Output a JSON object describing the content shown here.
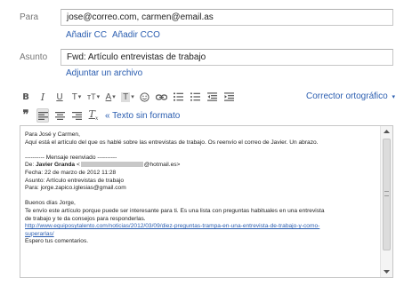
{
  "recipients": {
    "to_label": "Para",
    "to_value": "jose@correo.com, carmen@email.as",
    "add_cc": "Añadir CC",
    "add_bcc": "Añadir CCO"
  },
  "subject": {
    "label": "Asunto",
    "value": "Fwd: Artículo entrevistas de trabajo",
    "attach_link": "Adjuntar un archivo"
  },
  "toolbar": {
    "bold": "B",
    "italic": "I",
    "underline": "U",
    "font": "T",
    "size": "тT",
    "text_color": "A",
    "bg_color": "T",
    "spellcheck": "Corrector ortográfico",
    "remove_format": "« Texto sin formato"
  },
  "editor": {
    "lines": {
      "l1": "Para José y Carmen,",
      "l2": "Aquí está el artículo del que os hablé sobre las entrevistas de trabajo. Os reenvío el correo de Javier. Un abrazo.",
      "fwd_header": "---------- Mensaje reenviado ----------",
      "de_label": "De:",
      "de_name": "Javier Granda",
      "de_lt": "<",
      "de_email_suffix": "@hotmail.es>",
      "fecha": "Fecha: 22 de marzo de 2012 11:28",
      "asunto": "Asunto: Artículo entrevistas de trabajo",
      "para": "Para: jorge.zapico.iglesias@gmail.com",
      "greeting": "Buenos días Jorge,",
      "body1": "Te envío este artículo porque puede ser interesante para ti. Es una lista con preguntas habituales en una entrevista",
      "body2": "de trabajo y te da consejos para responderlas.",
      "url1": "http://www.equiposytalento.com/noticias/2012/03/09/diez-preguntas-trampa-en-una-entrevista-de-trabajo-y-como-",
      "url2": "superarlas/",
      "closing": "Espero tus comentarios."
    }
  },
  "colors": {
    "link": "#2a5db0",
    "label": "#777777",
    "border": "#c6c6c6"
  }
}
